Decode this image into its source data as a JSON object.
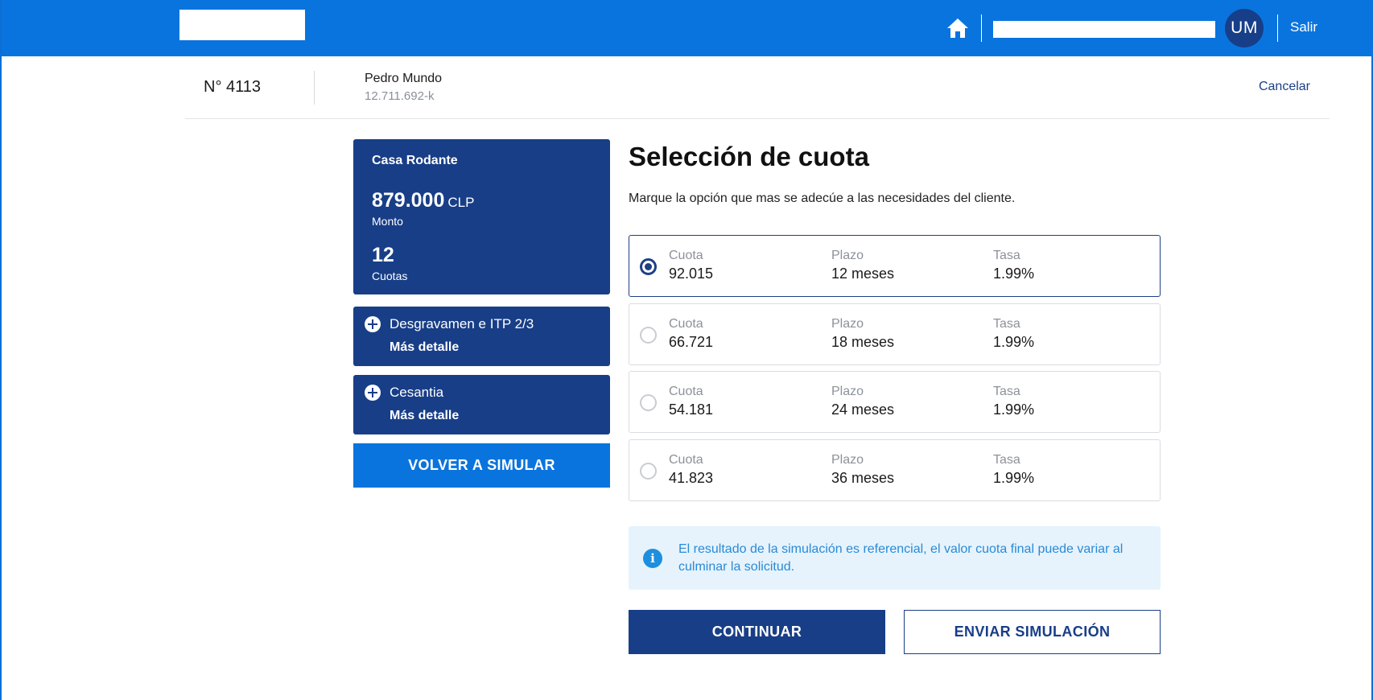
{
  "header": {
    "avatar_initials": "UM",
    "logout_label": "Salir",
    "colors": {
      "bar": "#0a74de",
      "avatar": "#173e88"
    }
  },
  "client": {
    "order_number": "N° 4113",
    "name": "Pedro Mundo",
    "rut": "12.711.692-k",
    "cancel_label": "Cancelar"
  },
  "summary": {
    "product": "Casa Rodante",
    "amount": "879.000",
    "currency": "CLP",
    "amount_caption": "Monto",
    "installments": "12",
    "installments_caption": "Cuotas"
  },
  "insurances": [
    {
      "title": "Desgravamen e ITP 2/3",
      "link": "Más detalle"
    },
    {
      "title": "Cesantia",
      "link": "Más detalle"
    }
  ],
  "resimulate_label": "VOLVER A SIMULAR",
  "selection": {
    "title": "Selección de cuota",
    "subtitle": "Marque la opción que mas se adecúe a las necesidades del cliente.",
    "options": [
      {
        "cuota_label": "Cuota",
        "cuota": "92.015",
        "plazo_label": "Plazo",
        "plazo": "12 meses",
        "tasa_label": "Tasa",
        "tasa": "1.99%",
        "selected": true
      },
      {
        "cuota_label": "Cuota",
        "cuota": "66.721",
        "plazo_label": "Plazo",
        "plazo": "18 meses",
        "tasa_label": "Tasa",
        "tasa": "1.99%",
        "selected": false
      },
      {
        "cuota_label": "Cuota",
        "cuota": "54.181",
        "plazo_label": "Plazo",
        "plazo": "24 meses",
        "tasa_label": "Tasa",
        "tasa": "1.99%",
        "selected": false
      },
      {
        "cuota_label": "Cuota",
        "cuota": "41.823",
        "plazo_label": "Plazo",
        "plazo": "36 meses",
        "tasa_label": "Tasa",
        "tasa": "1.99%",
        "selected": false
      }
    ]
  },
  "notice": {
    "text": "El resultado de la simulación es referencial, el valor cuota final puede variar al culminar la solicitud."
  },
  "actions": {
    "continue_label": "CONTINUAR",
    "send_label": "ENVIAR SIMULACIÓN"
  },
  "icons": [
    "home-icon",
    "plus-circle-icon",
    "info-icon",
    "radio-icon"
  ]
}
